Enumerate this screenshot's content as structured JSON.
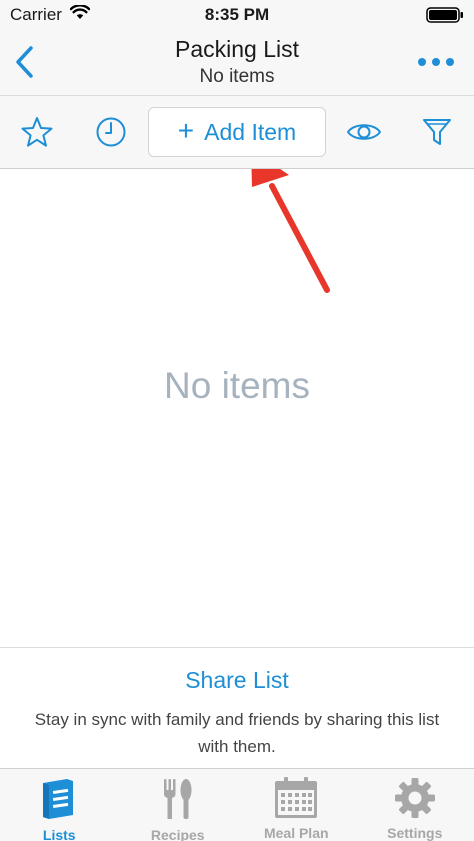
{
  "status_bar": {
    "carrier": "Carrier",
    "time": "8:35 PM"
  },
  "nav": {
    "title": "Packing List",
    "subtitle": "No items"
  },
  "toolbar": {
    "add_item_label": "Add Item",
    "icons": [
      "star-icon",
      "clock-icon",
      "eye-icon",
      "filter-icon"
    ]
  },
  "main": {
    "empty_text": "No items"
  },
  "share": {
    "title": "Share List",
    "description": "Stay in sync with family and friends by sharing this list with them."
  },
  "tabs": [
    {
      "label": "Lists",
      "icon": "lists-icon",
      "active": true
    },
    {
      "label": "Recipes",
      "icon": "fork-knife-icon",
      "active": false
    },
    {
      "label": "Meal Plan",
      "icon": "calendar-icon",
      "active": false
    },
    {
      "label": "Settings",
      "icon": "gear-icon",
      "active": false
    }
  ],
  "colors": {
    "accent": "#1e8fd6",
    "annotation_arrow": "#e8372a",
    "empty_text": "#a6b2bd",
    "inactive_tab": "#a7a7a7"
  }
}
